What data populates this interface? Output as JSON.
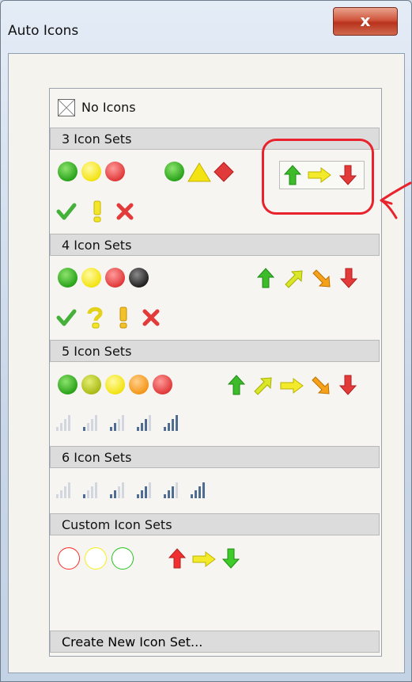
{
  "window": {
    "title": "Auto Icons",
    "close_label": "x"
  },
  "panel": {
    "no_icons_label": "No Icons",
    "sections": [
      {
        "label": "3 Icon Sets"
      },
      {
        "label": "4 Icon Sets"
      },
      {
        "label": "5 Icon Sets"
      },
      {
        "label": "6 Icon Sets"
      },
      {
        "label": "Custom Icon Sets"
      }
    ],
    "create_label": "Create New Icon Set..."
  },
  "colors": {
    "green": "#2aa31a",
    "yellow": "#f3e312",
    "red": "#e03a3a",
    "orange": "#f5961a",
    "olive": "#aabb18",
    "annotation": "#e8232d",
    "custom_ring_red": "#ff2a2a",
    "custom_ring_yellow": "#f4ef18",
    "custom_ring_green": "#22c51e",
    "arrow_green": "#3dbb2a",
    "arrow_red": "#e33a3a",
    "arrow_yellow": "#f2ea2a",
    "arrow_orange": "#f5a21a"
  }
}
